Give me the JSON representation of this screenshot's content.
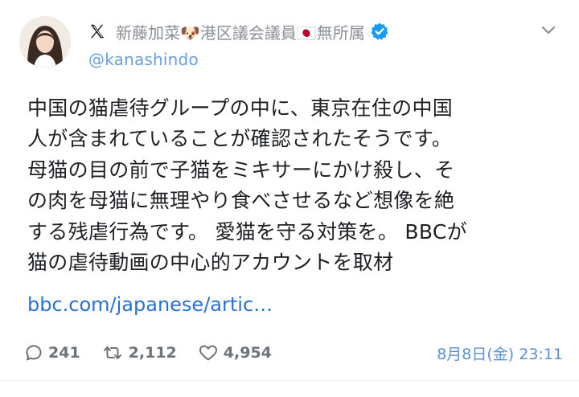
{
  "author": {
    "display_name": "新藤加菜🐶港区議会議員🇯🇵無所属",
    "handle": "@kanashindo",
    "verified": true,
    "avatar_icon": "avatar-photo",
    "platform_icon": "x-logo-icon"
  },
  "post": {
    "lines": [
      "中国の猫虐待グループの中に、東京在住の中国",
      "人が含まれていることが確認されたそうです。",
      "母猫の目の前で子猫をミキサーにかけ殺し、そ",
      "の肉を母猫に無理やり食べさせるなど想像を絶",
      "する残虐行為です。 愛猫を守る対策を。 BBCが",
      "猫の虐待動画の中心的アカウントを取材"
    ],
    "link": "bbc.com/japanese/artic…"
  },
  "stats": {
    "replies": "241",
    "reposts": "2,112",
    "likes": "4,954"
  },
  "timestamp": "8月8日(金) 23:11",
  "colors": {
    "handle": "#6b9fd9",
    "link": "#2a6fd6",
    "verified": "#1d9bf0",
    "timestamp": "#5b8fd6"
  }
}
